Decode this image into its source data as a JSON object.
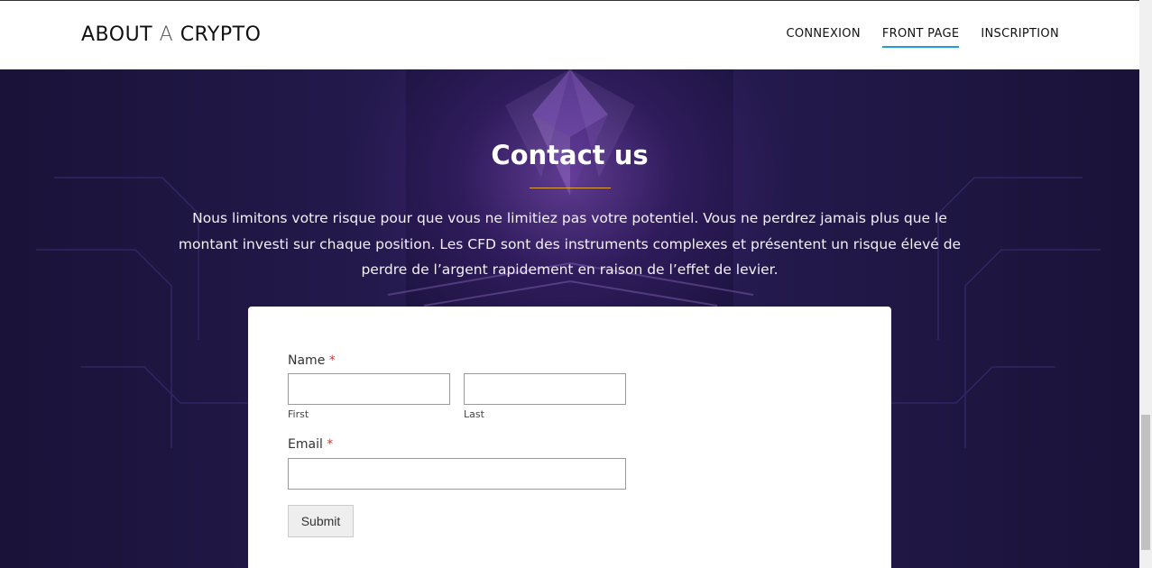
{
  "site": {
    "logo_part1": "ABOUT",
    "logo_part2": "A",
    "logo_part3": "CRYPTO"
  },
  "nav": {
    "items": [
      {
        "label": "CONNEXION",
        "active": false
      },
      {
        "label": "FRONT PAGE",
        "active": true
      },
      {
        "label": "INSCRIPTION",
        "active": false
      }
    ]
  },
  "hero": {
    "title": "Contact us",
    "intro": "Nous limitons votre risque pour que vous ne limitiez pas votre potentiel. Vous ne perdrez jamais plus que le montant investi sur chaque position. Les CFD sont des instruments complexes et présentent un risque élevé de perdre de l’argent rapidement en raison de l’effet de levier."
  },
  "form": {
    "name_label": "Name",
    "required_mark": "*",
    "first_sublabel": "First",
    "last_sublabel": "Last",
    "first_value": "",
    "last_value": "",
    "email_label": "Email",
    "email_value": "",
    "submit_label": "Submit"
  },
  "colors": {
    "accent": "#1e9fd8",
    "hero_bg": "#1c1440",
    "title_rule": "#e2a33a",
    "required": "#d63638"
  }
}
